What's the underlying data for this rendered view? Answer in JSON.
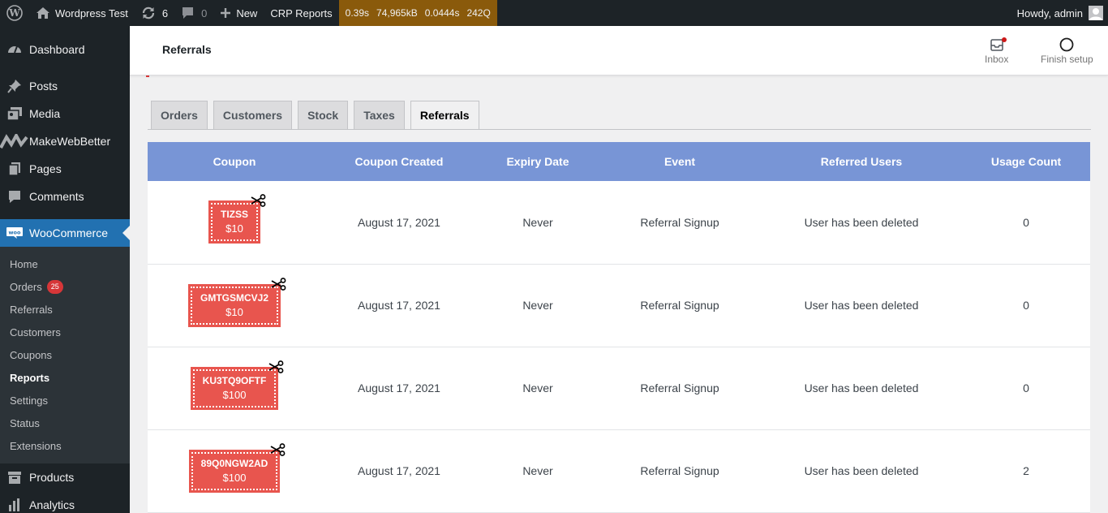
{
  "adminbar": {
    "site_name": "Wordpress Test",
    "updates_count": "6",
    "comments_count": "0",
    "new_label": "New",
    "crp_reports_label": "CRP Reports",
    "qm_time": "0.39s",
    "qm_memory": "74,965kB",
    "qm_db_time": "0.0444s",
    "qm_queries": "242Q",
    "howdy": "Howdy, admin"
  },
  "sidebar": {
    "items": [
      {
        "label": "Dashboard",
        "icon": "dashboard-icon"
      },
      {
        "label": "Posts",
        "icon": "pin-icon"
      },
      {
        "label": "Media",
        "icon": "media-icon"
      },
      {
        "label": "MakeWebBetter",
        "icon": "makewebbetter-icon"
      },
      {
        "label": "Pages",
        "icon": "pages-icon"
      },
      {
        "label": "Comments",
        "icon": "comment-icon"
      },
      {
        "label": "WooCommerce",
        "icon": "woo-icon"
      },
      {
        "label": "Products",
        "icon": "archive-icon"
      },
      {
        "label": "Analytics",
        "icon": "chart-bar-icon"
      }
    ],
    "woocommerce_submenu": [
      {
        "label": "Home"
      },
      {
        "label": "Orders",
        "badge": "25"
      },
      {
        "label": "Referrals"
      },
      {
        "label": "Customers"
      },
      {
        "label": "Coupons"
      },
      {
        "label": "Reports"
      },
      {
        "label": "Settings"
      },
      {
        "label": "Status"
      },
      {
        "label": "Extensions"
      }
    ]
  },
  "header": {
    "title": "Referrals",
    "inbox_label": "Inbox",
    "finish_setup_label": "Finish setup"
  },
  "tabs": [
    "Orders",
    "Customers",
    "Stock",
    "Taxes",
    "Referrals"
  ],
  "active_tab": "Referrals",
  "table": {
    "headers": [
      "Coupon",
      "Coupon Created",
      "Expiry Date",
      "Event",
      "Referred Users",
      "Usage Count"
    ],
    "rows": [
      {
        "code": "TIZSS",
        "amount": "$10",
        "created": "August 17, 2021",
        "expiry": "Never",
        "event": "Referral Signup",
        "users": "User has been deleted",
        "count": "0"
      },
      {
        "code": "GMTGSMCVJ2",
        "amount": "$10",
        "created": "August 17, 2021",
        "expiry": "Never",
        "event": "Referral Signup",
        "users": "User has been deleted",
        "count": "0"
      },
      {
        "code": "KU3TQ9OFTF",
        "amount": "$100",
        "created": "August 17, 2021",
        "expiry": "Never",
        "event": "Referral Signup",
        "users": "User has been deleted",
        "count": "0"
      },
      {
        "code": "89Q0NGW2AD",
        "amount": "$100",
        "created": "August 17, 2021",
        "expiry": "Never",
        "event": "Referral Signup",
        "users": "User has been deleted",
        "count": "2"
      }
    ]
  },
  "colors": {
    "adminbar_bg": "#1d2327",
    "accent_blue": "#2271b1",
    "table_header_bg": "#7895d6",
    "coupon_bg": "#e8554e",
    "qm_bg": "#8a5a0b",
    "badge_red": "#d63638"
  }
}
